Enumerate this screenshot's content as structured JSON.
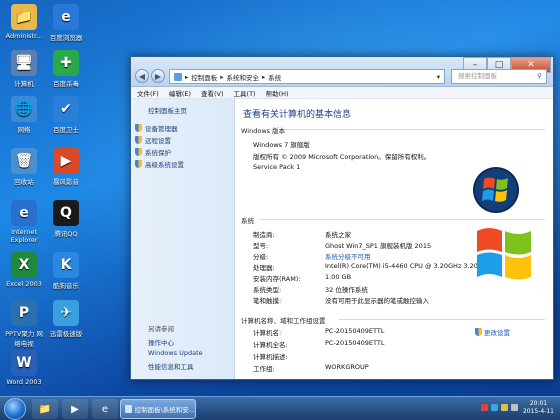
{
  "desktop": {
    "icons": [
      {
        "label": "Administr...",
        "glyph": "📁"
      },
      {
        "label": "百度浏览器",
        "glyph": "e"
      },
      {
        "label": "计算机",
        "glyph": "🖥"
      },
      {
        "label": "百度杀毒",
        "glyph": "✚"
      },
      {
        "label": "网络",
        "glyph": "🌐"
      },
      {
        "label": "百度卫士",
        "glyph": "✔"
      },
      {
        "label": "回收站",
        "glyph": "🗑"
      },
      {
        "label": "暴风影音",
        "glyph": "▶"
      },
      {
        "label": "Internet Explorer",
        "glyph": "e"
      },
      {
        "label": "腾讯QQ",
        "glyph": "Q"
      },
      {
        "label": "Excel 2003",
        "glyph": "X"
      },
      {
        "label": "酷狗音乐",
        "glyph": "K"
      },
      {
        "label": "PPTV聚力 网络电视",
        "glyph": "P"
      },
      {
        "label": "迅雷极速版",
        "glyph": "✈"
      },
      {
        "label": "Word 2003",
        "glyph": "W"
      }
    ]
  },
  "window": {
    "breadcrumb": [
      "控制面板",
      "系统和安全",
      "系统"
    ],
    "search_placeholder": "搜索控制面板",
    "menu": [
      "文件(F)",
      "编辑(E)",
      "查看(V)",
      "工具(T)",
      "帮助(H)"
    ],
    "left_pane": {
      "home": "控制面板主页",
      "items": [
        "设备管理器",
        "远程设置",
        "系统保护",
        "高级系统设置"
      ],
      "see_also_title": "另请参阅",
      "see_also": [
        "操作中心",
        "Windows Update",
        "性能信息和工具"
      ]
    },
    "main": {
      "heading": "查看有关计算机的基本信息",
      "edition_section": "Windows 版本",
      "edition": "Windows 7 旗舰版",
      "copyright": "版权所有 © 2009 Microsoft Corporation。保留所有权利。",
      "service_pack": "Service Pack 1",
      "system_section": "系统",
      "system_rows": [
        {
          "label": "制造商:",
          "value": "系统之家",
          "is_link": false
        },
        {
          "label": "型号:",
          "value": "Ghost Win7_SP1 旗舰装机版 2015",
          "is_link": false
        },
        {
          "label": "分级:",
          "value": "系统分级不可用",
          "is_link": true
        },
        {
          "label": "处理器:",
          "value": "Intel(R) Core(TM) i5-4460  CPU @ 3.20GHz   3.20 GHz",
          "is_link": false
        },
        {
          "label": "安装内存(RAM):",
          "value": "1.00 GB",
          "is_link": false
        },
        {
          "label": "系统类型:",
          "value": "32 位操作系统",
          "is_link": false
        },
        {
          "label": "笔和触摸:",
          "value": "没有可用于此显示器的笔或触控输入",
          "is_link": false
        }
      ],
      "computer_section": "计算机名称、域和工作组设置",
      "computer_rows": [
        {
          "label": "计算机名:",
          "value": "PC-20150409ETTL"
        },
        {
          "label": "计算机全名:",
          "value": "PC-20150409ETTL"
        },
        {
          "label": "计算机描述:",
          "value": ""
        },
        {
          "label": "工作组:",
          "value": "WORKGROUP"
        }
      ],
      "change_settings": "更改设置"
    }
  },
  "taskbar": {
    "task_label": "控制面板\\系统和安...",
    "time": "20:01",
    "date": "2015-4-11"
  },
  "colors": {
    "accent": "#1e3f8f",
    "link": "#1c5bb8"
  }
}
